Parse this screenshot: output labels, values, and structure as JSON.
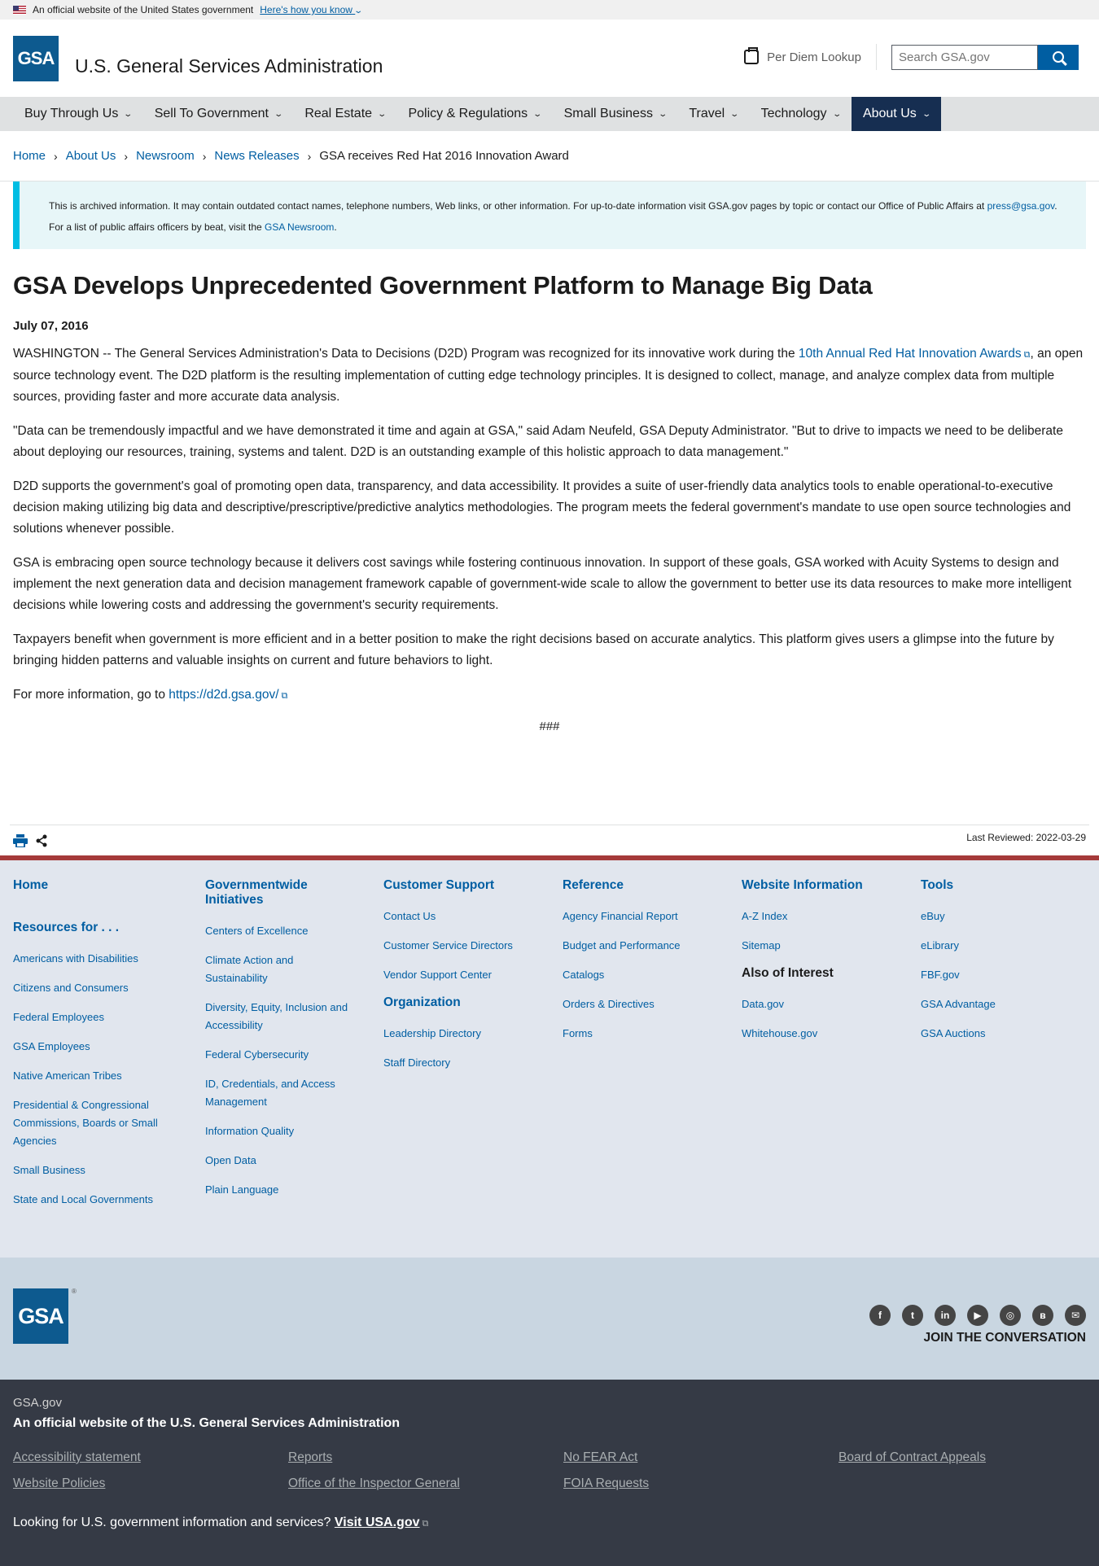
{
  "gov_banner": {
    "text": "An official website of the United States government",
    "link": "Here's how you know"
  },
  "header": {
    "logo": "GSA",
    "title": "U.S. General Services Administration",
    "per_diem": "Per Diem Lookup",
    "search_placeholder": "Search GSA.gov"
  },
  "nav": [
    {
      "label": "Buy Through Us"
    },
    {
      "label": "Sell To Government"
    },
    {
      "label": "Real Estate"
    },
    {
      "label": "Policy & Regulations"
    },
    {
      "label": "Small Business"
    },
    {
      "label": "Travel"
    },
    {
      "label": "Technology"
    },
    {
      "label": "About Us"
    }
  ],
  "breadcrumb": {
    "home": "Home",
    "about": "About Us",
    "newsroom": "Newsroom",
    "releases": "News Releases",
    "current": "GSA receives Red Hat 2016 Innovation Award"
  },
  "alert": {
    "text1": "This is archived information. It may contain outdated contact names, telephone numbers, Web links, or other information. For up-to-date information visit GSA.gov pages by topic or contact our Office of Public Affairs at",
    "email": "press@gsa.gov",
    "text2": "For a list of public affairs officers by beat, visit the",
    "newsroom": "GSA Newsroom"
  },
  "article": {
    "title": "GSA Develops Unprecedented Government Platform to Manage Big Data",
    "date": "July 07, 2016",
    "p1_a": "WASHINGTON -- The General Services Administration's Data to Decisions (D2D) Program was recognized for its innovative work during the ",
    "p1_link": "10th Annual Red Hat Innovation Awards",
    "p1_b": ", an open source technology event. The D2D platform is the resulting implementation of cutting edge technology principles. It is designed to collect, manage, and analyze complex data from multiple sources, providing faster and more accurate data analysis.",
    "p2": "\"Data can be tremendously impactful and we have demonstrated it time and again at GSA,\" said Adam Neufeld, GSA Deputy Administrator. \"But to drive to impacts we need to be deliberate about deploying our resources, training, systems and talent. D2D is an outstanding example of this holistic approach to data management.\"",
    "p3": "D2D supports the government's goal of promoting open data, transparency, and data accessibility. It provides a suite of user-friendly data analytics tools to enable operational-to-executive decision making utilizing big data and descriptive/prescriptive/predictive analytics methodologies. The program meets the federal government's mandate to use open source technologies and solutions whenever possible.",
    "p4": "GSA is embracing open source technology because it delivers cost savings while fostering continuous innovation. In support of these goals, GSA worked with Acuity Systems to design and implement the next generation data and decision management framework capable of government-wide scale to allow the government to better use its data resources to make more intelligent decisions while lowering costs and addressing the government's security requirements.",
    "p5": "Taxpayers benefit when government is more efficient and in a better position to make the right decisions based on accurate analytics. This platform gives users a glimpse into the future by bringing hidden patterns and valuable insights on current and future behaviors to light.",
    "p6_a": "For more information, go to ",
    "p6_link": "https://d2d.gsa.gov/",
    "end": "###"
  },
  "last_reviewed": "Last Reviewed: 2022-03-29",
  "footer": {
    "col1": {
      "home": "Home",
      "resources": "Resources for . . .",
      "items": [
        "Americans with Disabilities",
        "Citizens and Consumers",
        "Federal Employees",
        "GSA Employees",
        "Native American Tribes",
        "Presidential & Congressional Commissions, Boards or Small Agencies",
        "Small Business",
        "State and Local Governments"
      ]
    },
    "col2": {
      "title": "Governmentwide Initiatives",
      "items": [
        "Centers of Excellence",
        "Climate Action and Sustainability",
        "Diversity, Equity, Inclusion and Accessibility",
        "Federal Cybersecurity",
        "ID, Credentials, and Access Management",
        "Information Quality",
        "Open Data",
        "Plain Language"
      ]
    },
    "col3": {
      "title": "Customer Support",
      "items": [
        "Contact Us",
        "Customer Service Directors",
        "Vendor Support Center"
      ],
      "title2": "Organization",
      "items2": [
        "Leadership Directory",
        "Staff Directory"
      ]
    },
    "col4": {
      "title": "Reference",
      "items": [
        "Agency Financial Report",
        "Budget and Performance",
        "Catalogs",
        "Orders & Directives",
        "Forms"
      ]
    },
    "col5": {
      "title": "Website Information",
      "items": [
        "A-Z Index",
        "Sitemap"
      ],
      "title2": "Also of Interest",
      "items2": [
        "Data.gov",
        "Whitehouse.gov"
      ]
    },
    "col6": {
      "title": "Tools",
      "items": [
        "eBuy",
        "eLibrary",
        "FBF.gov",
        "GSA Advantage",
        "GSA Auctions"
      ]
    },
    "logo": "GSA",
    "join": "JOIN THE CONVERSATION",
    "site": "GSA.gov",
    "official": "An official website of the U.S. General Services Administration",
    "bottom_links": [
      "Accessibility statement",
      "Reports",
      "No FEAR Act",
      "Board of Contract Appeals",
      "Website Policies",
      "Office of the Inspector General",
      "FOIA Requests"
    ],
    "usa_text": "Looking for U.S. government information and services?",
    "usa_link": "Visit USA.gov"
  }
}
